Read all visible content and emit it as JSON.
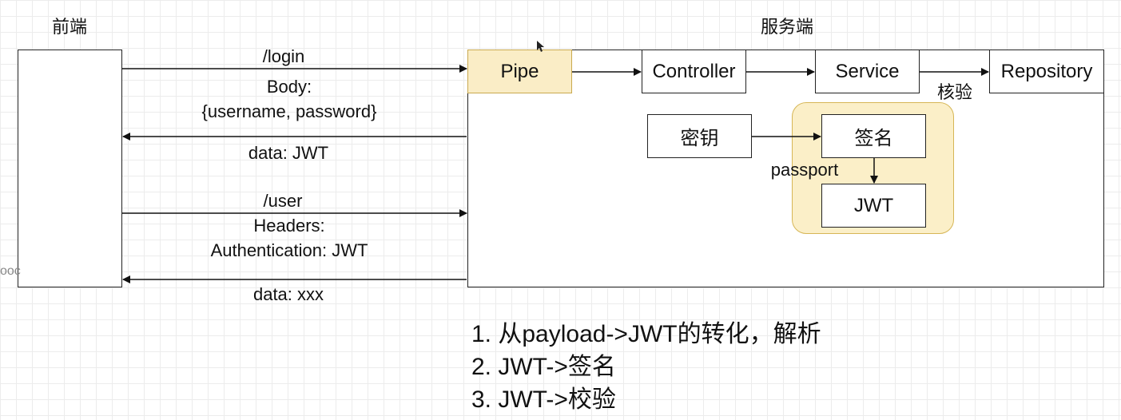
{
  "frontend": {
    "title": "前端"
  },
  "server": {
    "title": "服务端",
    "pipe": "Pipe",
    "controller": "Controller",
    "service": "Service",
    "repository": "Repository",
    "verify_label": "核验",
    "secret_key": "密钥",
    "signature": "签名",
    "passport_label": "passport",
    "jwt": "JWT"
  },
  "arrows": {
    "login": {
      "path": "/login",
      "body_title": "Body:",
      "body_value": "{username, password}"
    },
    "login_response": "data: JWT",
    "user": {
      "path": "/user",
      "headers_title": "Headers:",
      "headers_value": "Authentication: JWT"
    },
    "user_response": "data: xxx"
  },
  "edge_text": "ooc",
  "notes": [
    "1. 从payload->JWT的转化，解析",
    "2. JWT->签名",
    "3. JWT->校验"
  ],
  "colors": {
    "pipe_fill": "#faedc6",
    "passport_group_fill": "#fbefc8",
    "passport_group_stroke": "#d6b656"
  }
}
